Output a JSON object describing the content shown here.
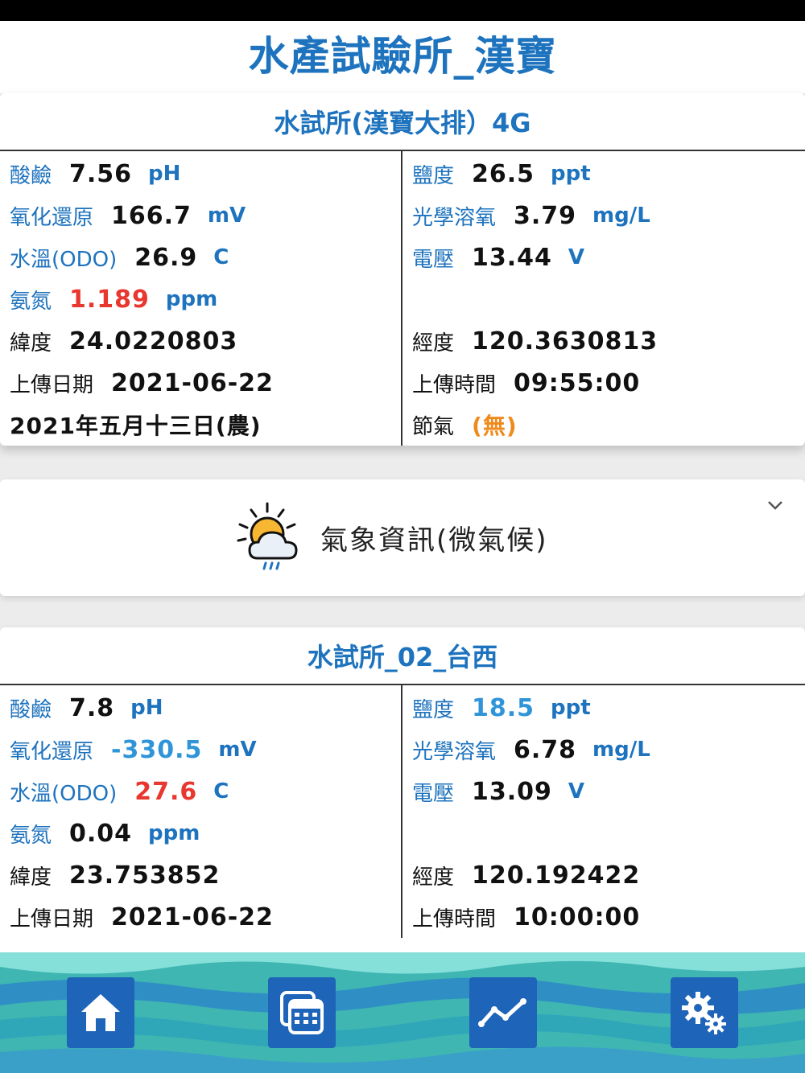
{
  "app": {
    "title": "水產試驗所_漢寶"
  },
  "stations": [
    {
      "title": "水試所(漢寶大排）4G",
      "left": [
        {
          "label": "酸鹼",
          "value": "7.56",
          "unit": "pH"
        },
        {
          "label": "氧化還原",
          "value": "166.7",
          "unit": "mV"
        },
        {
          "label": "水溫(ODO)",
          "value": "26.9",
          "unit": "C"
        },
        {
          "label": "氨氮",
          "value": "1.189",
          "unit": "ppm"
        },
        {
          "label": "緯度",
          "value": "24.0220803"
        },
        {
          "label": "上傳日期",
          "value": "2021-06-22"
        },
        {
          "label": "2021年五月十三日(農)"
        }
      ],
      "right": [
        {
          "label": "鹽度",
          "value": "26.5",
          "unit": "ppt"
        },
        {
          "label": "光學溶氧",
          "value": "3.79",
          "unit": "mg/L"
        },
        {
          "label": "電壓",
          "value": "13.44",
          "unit": "V"
        },
        {
          "label": "經度",
          "value": "120.3630813"
        },
        {
          "label": "上傳時間",
          "value": "09:55:00"
        },
        {
          "label": "節氣",
          "value": "(無)"
        }
      ]
    },
    {
      "title": "水試所_02_台西",
      "left": [
        {
          "label": "酸鹼",
          "value": "7.8",
          "unit": "pH"
        },
        {
          "label": "氧化還原",
          "value": "-330.5",
          "unit": "mV"
        },
        {
          "label": "水溫(ODO)",
          "value": "27.6",
          "unit": "C"
        },
        {
          "label": "氨氮",
          "value": "0.04",
          "unit": "ppm"
        },
        {
          "label": "緯度",
          "value": "23.753852"
        },
        {
          "label": "上傳日期",
          "value": "2021-06-22"
        }
      ],
      "right": [
        {
          "label": "鹽度",
          "value": "18.5",
          "unit": "ppt"
        },
        {
          "label": "光學溶氧",
          "value": "6.78",
          "unit": "mg/L"
        },
        {
          "label": "電壓",
          "value": "13.09",
          "unit": "V"
        },
        {
          "label": "經度",
          "value": "120.192422"
        },
        {
          "label": "上傳時間",
          "value": "10:00:00"
        }
      ]
    }
  ],
  "weather": {
    "label": "氣象資訊(微氣候)",
    "icon": "sun-cloud-rain-icon"
  },
  "nav": [
    {
      "name": "home-icon"
    },
    {
      "name": "calendar-icon"
    },
    {
      "name": "chart-line-icon"
    },
    {
      "name": "gears-icon"
    }
  ],
  "colors": {
    "primary": "#1e73be",
    "alert_red": "#e8372f",
    "highlight_blue": "#2f95d8",
    "orange": "#f08a1c",
    "nav_button": "#1e64b8"
  }
}
